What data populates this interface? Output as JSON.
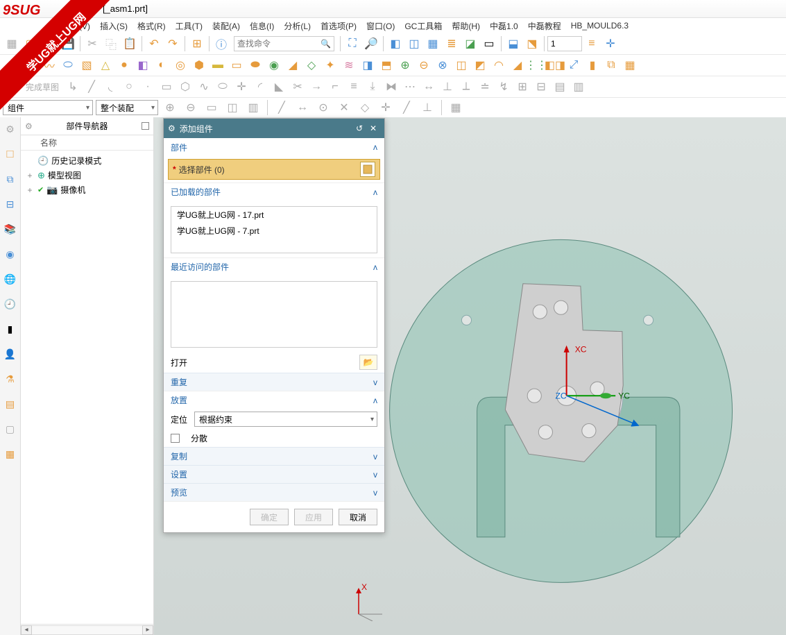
{
  "title": "- [_asm1.prt]",
  "watermark_small": "9SUG",
  "watermark_band": "学UG就上UG网",
  "menubar": [
    "视图(V)",
    "插入(S)",
    "格式(R)",
    "工具(T)",
    "装配(A)",
    "信息(I)",
    "分析(L)",
    "首选项(P)",
    "窗口(O)",
    "GC工具箱",
    "帮助(H)",
    "中磊1.0",
    "中磊教程",
    "HB_MOULD6.3"
  ],
  "search_placeholder": "查找命令",
  "finish_sketch_label": "完成草图",
  "spin_value": "1",
  "combo_component": "组件",
  "combo_assembly": "整个装配",
  "nav": {
    "title": "部件导航器",
    "col_name": "名称",
    "items": {
      "history": "历史记录模式",
      "modelview": "模型视图",
      "camera": "摄像机"
    }
  },
  "dialog": {
    "title": "添加组件",
    "parts_h": "部件",
    "select_comp": "选择部件 (0)",
    "loaded_h": "已加载的部件",
    "loaded": [
      "学UG就上UG网 - 17.prt",
      "学UG就上UG网 - 7.prt"
    ],
    "recent_h": "最近访问的部件",
    "open_label": "打开",
    "repeat": "重复",
    "place_h": "放置",
    "pos_label": "定位",
    "pos_value": "根据约束",
    "scatter": "分散",
    "copy_h": "复制",
    "settings_h": "设置",
    "preview_h": "预览",
    "ok": "确定",
    "apply": "应用",
    "cancel": "取消"
  },
  "axis": {
    "x": "X",
    "xc": "XC",
    "yc": "YC",
    "zc": "ZC"
  }
}
